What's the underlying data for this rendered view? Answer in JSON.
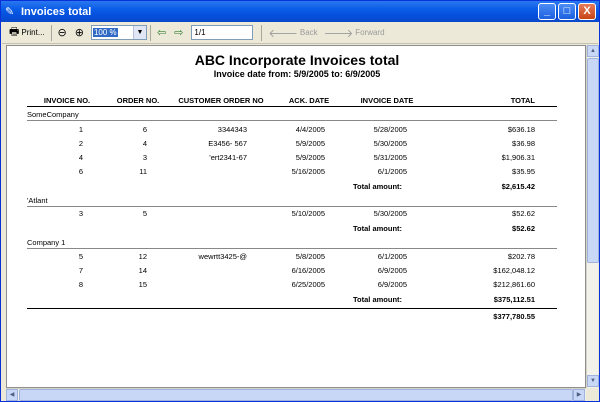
{
  "window": {
    "title": "Invoices total",
    "buttons": {
      "minimize": "_",
      "maximize": "□",
      "close": "X"
    }
  },
  "toolbar": {
    "print_label": "Print...",
    "zoom_value": "100 %",
    "page_value": "1/1",
    "back_label": "Back",
    "forward_label": "Forward"
  },
  "report": {
    "title": "ABC Incorporate Invoices total",
    "subtitle": "Invoice date from: 5/9/2005  to: 6/9/2005",
    "columns": [
      "INVOICE NO.",
      "ORDER NO.",
      "CUSTOMER ORDER NO",
      "ACK. DATE",
      "INVOICE DATE",
      "TOTAL"
    ],
    "groups": [
      {
        "name": "SomeCompany",
        "rows": [
          [
            "1",
            "6",
            "3344343",
            "4/4/2005",
            "5/28/2005",
            "$636.18"
          ],
          [
            "2",
            "4",
            "E3456- 567",
            "5/9/2005",
            "5/30/2005",
            "$36.98"
          ],
          [
            "4",
            "3",
            "'ert2341-67",
            "5/9/2005",
            "5/31/2005",
            "$1,906.31"
          ],
          [
            "6",
            "11",
            "",
            "5/16/2005",
            "6/1/2005",
            "$35.95"
          ]
        ],
        "total_label": "Total amount:",
        "total": "$2,615.42"
      },
      {
        "name": "'Atlant",
        "rows": [
          [
            "3",
            "5",
            "",
            "5/10/2005",
            "5/30/2005",
            "$52.62"
          ]
        ],
        "total_label": "Total amount:",
        "total": "$52.62"
      },
      {
        "name": "Company 1",
        "rows": [
          [
            "5",
            "12",
            "wewrtt3425-@",
            "5/8/2005",
            "6/1/2005",
            "$202.78"
          ],
          [
            "7",
            "14",
            "",
            "6/16/2005",
            "6/9/2005",
            "$162,048.12"
          ],
          [
            "8",
            "15",
            "",
            "6/25/2005",
            "6/9/2005",
            "$212,861.60"
          ]
        ],
        "total_label": "Total amount:",
        "total": "$375,112.51"
      }
    ],
    "grand_total": "$377,780.55"
  },
  "colors": {
    "titlebar": "#0a5ce6",
    "selection": "#316ac5"
  },
  "icons": [
    "report-icon",
    "printer-icon",
    "zoom-out-icon",
    "zoom-in-icon",
    "page-prev-icon",
    "page-next-icon",
    "back-arrow-icon",
    "forward-arrow-icon"
  ]
}
